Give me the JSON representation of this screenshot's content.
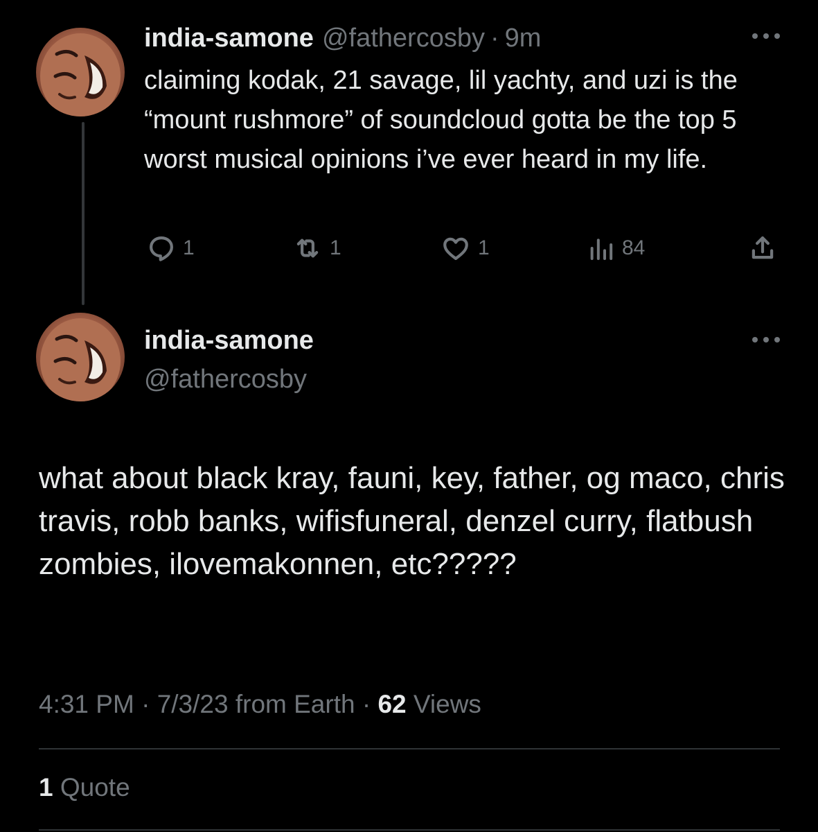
{
  "parent_tweet": {
    "display_name": "india-samone",
    "handle": "@fathercosby",
    "separator": "·",
    "time_ago": "9m",
    "text": "claiming kodak, 21 savage, lil yachty, and uzi is the “mount rushmore” of soundcloud gotta be the top 5 worst musical opinions i’ve ever heard in my life.",
    "actions": {
      "reply_count": "1",
      "retweet_count": "1",
      "like_count": "1",
      "view_count": "84"
    },
    "icons": [
      "avatar",
      "more-icon",
      "reply-icon",
      "retweet-icon",
      "like-icon",
      "views-icon",
      "share-icon"
    ]
  },
  "main_tweet": {
    "display_name": "india-samone",
    "handle": "@fathercosby",
    "text": "what about black kray, fauni, key, father, og maco, chris travis, robb banks, wifisfuneral, denzel curry, flatbush zombies, ilovemakonnen, etc?????",
    "time": "4:31 PM",
    "date": "7/3/23 from Earth",
    "separator": "·",
    "views_count": "62",
    "views_label": "Views",
    "quote_count": "1",
    "quote_label": "Quote"
  },
  "colors": {
    "background": "#000000",
    "primary_text": "#e7e9ea",
    "secondary_text": "#71767b",
    "divider": "#2f3336",
    "thread_line": "#333639"
  }
}
